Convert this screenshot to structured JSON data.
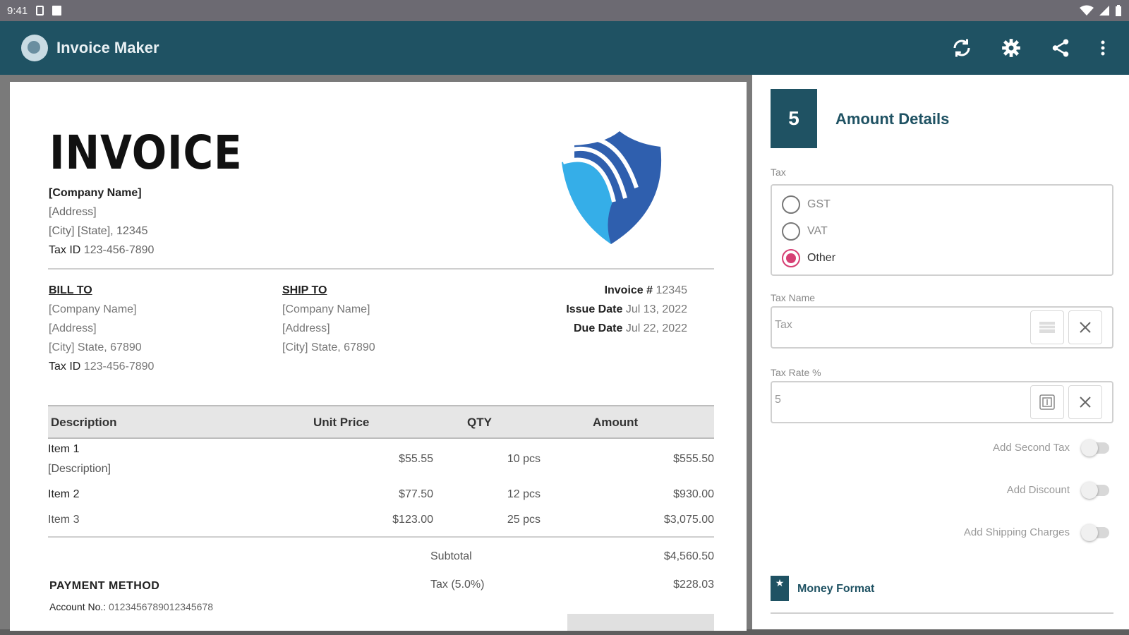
{
  "status_bar": {
    "time": "9:41"
  },
  "app_bar": {
    "title": "Invoice Maker"
  },
  "invoice": {
    "title": "INVOICE",
    "company": {
      "name": "[Company Name]",
      "address": "[Address]",
      "city": "[City] [State], 12345",
      "tax_id_label": "Tax ID",
      "tax_id": "123-456-7890"
    },
    "bill_to": {
      "heading": "BILL TO",
      "name": "[Company Name]",
      "address": "[Address]",
      "city": "[City] State, 67890",
      "tax_id_label": "Tax ID",
      "tax_id": "123-456-7890"
    },
    "ship_to": {
      "heading": "SHIP TO",
      "name": "[Company Name]",
      "address": "[Address]",
      "city": "[City] State, 67890"
    },
    "meta": {
      "invoice_label": "Invoice #",
      "invoice_no": "12345",
      "issue_label": "Issue Date",
      "issue_date": "Jul 13, 2022",
      "due_label": "Due Date",
      "due_date": "Jul 22, 2022"
    },
    "table": {
      "headers": {
        "description": "Description",
        "unit_price": "Unit Price",
        "qty": "QTY",
        "amount": "Amount"
      },
      "rows": [
        {
          "name": "Item 1",
          "description": "[Description]",
          "unit_price": "$55.55",
          "qty": "10 pcs",
          "amount": "$555.50"
        },
        {
          "name": "Item 2",
          "unit_price": "$77.50",
          "qty": "12 pcs",
          "amount": "$930.00"
        },
        {
          "name": "Item 3",
          "unit_price": "$123.00",
          "qty": "25 pcs",
          "amount": "$3,075.00"
        }
      ]
    },
    "totals": {
      "subtotal_label": "Subtotal",
      "subtotal": "$4,560.50",
      "tax_label": "Tax (5.0%)",
      "tax": "$228.03"
    },
    "payment": {
      "heading": "PAYMENT METHOD",
      "account_label": "Account No.:",
      "account_no": "0123456789012345678"
    }
  },
  "panel": {
    "step_number": "5",
    "title": "Amount Details",
    "tax_label": "Tax",
    "tax_options": [
      {
        "label": "GST",
        "selected": false
      },
      {
        "label": "VAT",
        "selected": false
      },
      {
        "label": "Other",
        "selected": true
      }
    ],
    "tax_name_label": "Tax Name",
    "tax_name_value": "Tax",
    "tax_rate_label": "Tax Rate %",
    "tax_rate_value": "5",
    "toggles": [
      {
        "label": "Add Second Tax",
        "on": false
      },
      {
        "label": "Add Discount",
        "on": false
      },
      {
        "label": "Add Shipping Charges",
        "on": false
      }
    ],
    "money_format_label": "Money Format"
  },
  "colors": {
    "primary": "#1f5263",
    "accent": "#d63f74",
    "shield_dark": "#2f5fae",
    "shield_light": "#35aee8"
  }
}
